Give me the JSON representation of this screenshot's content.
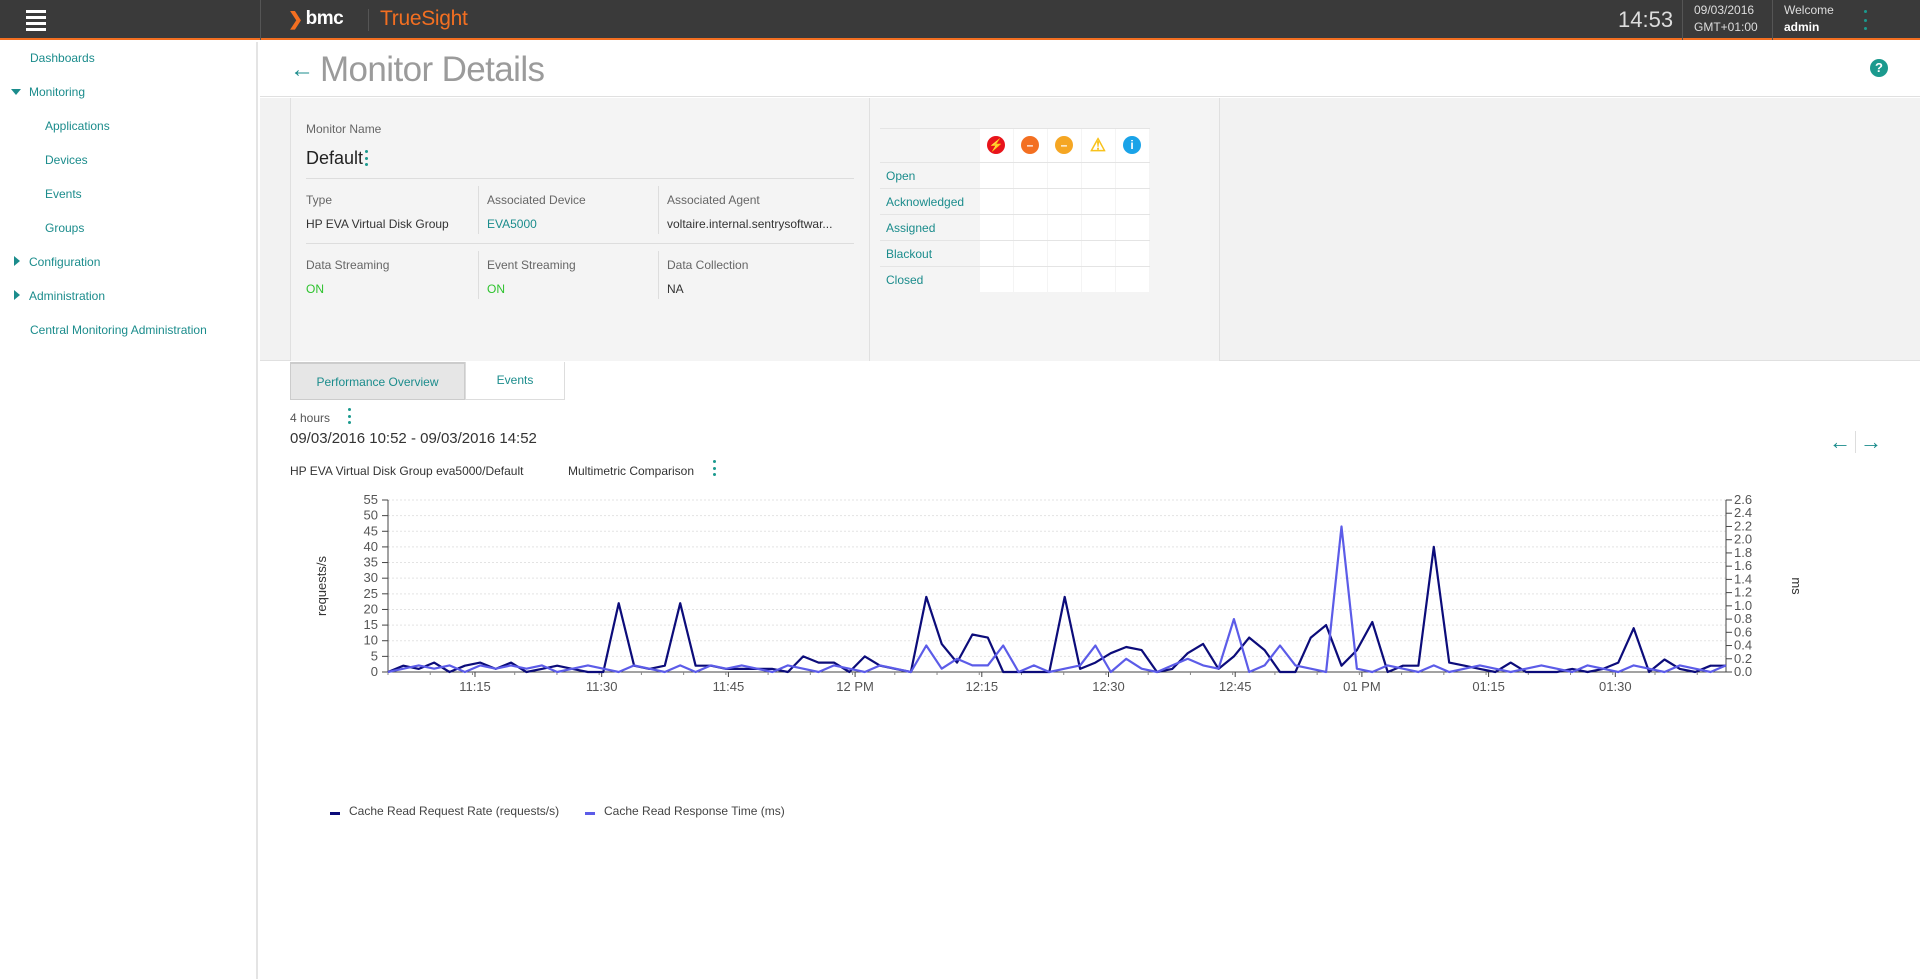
{
  "app": {
    "brand": "bmc",
    "product": "TrueSight",
    "clock": "14:53",
    "date": "09/03/2016",
    "timezone": "GMT+01:00",
    "welcome": "Welcome",
    "user": "admin"
  },
  "sidebar": {
    "items": [
      {
        "label": "Dashboards"
      },
      {
        "label": "Monitoring"
      },
      {
        "label": "Applications"
      },
      {
        "label": "Devices"
      },
      {
        "label": "Events"
      },
      {
        "label": "Groups"
      },
      {
        "label": "Configuration"
      },
      {
        "label": "Administration"
      },
      {
        "label": "Central Monitoring Administration"
      }
    ]
  },
  "page": {
    "title": "Monitor Details",
    "help": "?"
  },
  "details": {
    "monitor_name_label": "Monitor Name",
    "monitor_name": "Default",
    "type_label": "Type",
    "type_value": "HP EVA Virtual Disk Group",
    "device_label": "Associated Device",
    "device_value": "EVA5000",
    "agent_label": "Associated Agent",
    "agent_value": "voltaire.internal.sentrysoftwar...",
    "data_streaming_label": "Data Streaming",
    "data_streaming_value": "ON",
    "event_streaming_label": "Event Streaming",
    "event_streaming_value": "ON",
    "data_collection_label": "Data Collection",
    "data_collection_value": "NA"
  },
  "events_table": {
    "rows": [
      "Open",
      "Acknowledged",
      "Assigned",
      "Blackout",
      "Closed"
    ],
    "severities": [
      {
        "name": "critical",
        "glyph": "⚡",
        "color": "#e8141b"
      },
      {
        "name": "major",
        "glyph": "–",
        "color": "#f36f21"
      },
      {
        "name": "minor",
        "glyph": "–",
        "color": "#f5a623"
      },
      {
        "name": "warning",
        "glyph": "!",
        "color": "#f8c21c"
      },
      {
        "name": "info",
        "glyph": "i",
        "color": "#1aa3e8"
      }
    ]
  },
  "tabs": [
    {
      "label": "Performance Overview",
      "active": true
    },
    {
      "label": "Events",
      "active": false
    }
  ],
  "range": {
    "duration": "4 hours",
    "dates": "09/03/2016 10:52 - 09/03/2016 14:52"
  },
  "chart_header": {
    "source": "HP EVA Virtual Disk Group eva5000/Default",
    "mode": "Multimetric Comparison"
  },
  "chart_data": {
    "type": "line",
    "x_ticks": [
      "11:15",
      "11:30",
      "11:45",
      "12 PM",
      "12:15",
      "12:30",
      "12:45",
      "01 PM",
      "01:15",
      "01:30"
    ],
    "ylabel": "requests/s",
    "y2label": "ms",
    "ylim": [
      0,
      55
    ],
    "y2lim": [
      0,
      2.6
    ],
    "y_ticks": [
      0,
      5,
      10,
      15,
      20,
      25,
      30,
      35,
      40,
      45,
      50,
      55
    ],
    "y2_ticks": [
      "0.0",
      "0.2",
      "0.4",
      "0.6",
      "0.8",
      "1.0",
      "1.2",
      "1.4",
      "1.6",
      "1.8",
      "2.0",
      "2.2",
      "2.4",
      "2.6"
    ],
    "grid": true,
    "series": [
      {
        "name": "Cache Read Request Rate (requests/s)",
        "color": "#0c0c7a",
        "axis": "left",
        "values": [
          0,
          2,
          1,
          3,
          0,
          2,
          3,
          1,
          3,
          0,
          1,
          2,
          1,
          0,
          0,
          22,
          2,
          1,
          2,
          22,
          2,
          2,
          1,
          1,
          1,
          1,
          0,
          5,
          3,
          3,
          0,
          5,
          2,
          1,
          0,
          24,
          9,
          3,
          12,
          11,
          0,
          0,
          0,
          0,
          24,
          1,
          3,
          6,
          8,
          7,
          0,
          1,
          6,
          9,
          1,
          5,
          11,
          7,
          0,
          0,
          11,
          15,
          2,
          7,
          16,
          0,
          2,
          2,
          40,
          3,
          2,
          1,
          0,
          3,
          0,
          0,
          0,
          1,
          0,
          1,
          3,
          14,
          0,
          4,
          1,
          0,
          2,
          2
        ]
      },
      {
        "name": "Cache Read Response Time (ms)",
        "color": "#5c5ce8",
        "axis": "right",
        "values": [
          0.0,
          0.05,
          0.1,
          0.05,
          0.1,
          0.0,
          0.1,
          0.05,
          0.1,
          0.05,
          0.1,
          0.0,
          0.05,
          0.1,
          0.05,
          0.0,
          0.1,
          0.05,
          0.0,
          0.1,
          0.0,
          0.1,
          0.05,
          0.1,
          0.05,
          0.0,
          0.1,
          0.05,
          0.0,
          0.1,
          0.05,
          0.0,
          0.1,
          0.05,
          0.0,
          0.4,
          0.05,
          0.2,
          0.1,
          0.1,
          0.4,
          0.0,
          0.1,
          0.0,
          0.05,
          0.1,
          0.4,
          0.0,
          0.2,
          0.05,
          0.0,
          0.1,
          0.2,
          0.1,
          0.05,
          0.8,
          0.0,
          0.1,
          0.4,
          0.1,
          0.05,
          0.0,
          2.2,
          0.05,
          0.0,
          0.1,
          0.05,
          0.0,
          0.1,
          0.0,
          0.05,
          0.1,
          0.05,
          0.0,
          0.05,
          0.1,
          0.05,
          0.0,
          0.1,
          0.05,
          0.0,
          0.1,
          0.05,
          0.0,
          0.1,
          0.05,
          0.0,
          0.1
        ]
      }
    ]
  }
}
